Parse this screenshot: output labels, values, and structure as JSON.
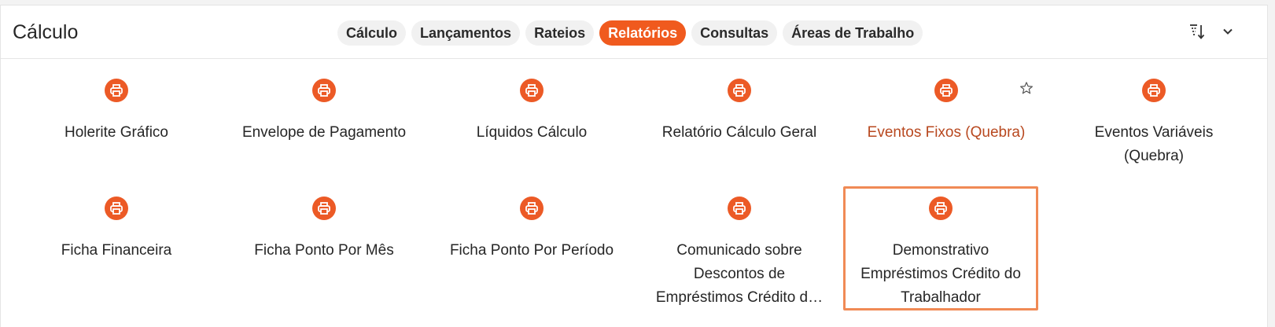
{
  "header": {
    "title": "Cálculo",
    "tabs": [
      {
        "label": "Cálculo"
      },
      {
        "label": "Lançamentos"
      },
      {
        "label": "Rateios"
      },
      {
        "label": "Relatórios"
      },
      {
        "label": "Consultas"
      },
      {
        "label": "Áreas de Trabalho"
      }
    ],
    "active_tab": "Relatórios",
    "tools": [
      "sort-icon",
      "chevron-down-icon"
    ]
  },
  "reports": [
    {
      "label": "Holerite Gráfico",
      "icon": "printer-icon"
    },
    {
      "label": "Envelope de Pagamento",
      "icon": "printer-icon"
    },
    {
      "label": "Líquidos Cálculo",
      "icon": "printer-icon"
    },
    {
      "label": "Relatório Cálculo Geral",
      "icon": "printer-icon"
    },
    {
      "label": "Eventos Fixos (Quebra)",
      "icon": "printer-icon",
      "hovered": true,
      "favorite_icon": "star-outline-icon"
    },
    {
      "label": "Eventos Variáveis (Quebra)",
      "icon": "printer-icon"
    },
    {
      "label": "Ficha Financeira",
      "icon": "printer-icon"
    },
    {
      "label": "Ficha Ponto Por Mês",
      "icon": "printer-icon"
    },
    {
      "label": "Ficha Ponto Por Período",
      "icon": "printer-icon"
    },
    {
      "label": "Comunicado sobre Descontos de Empréstimos Crédito d…",
      "icon": "printer-icon"
    },
    {
      "label": "Demonstrativo Empréstimos Crédito do Trabalhador",
      "icon": "printer-icon",
      "selected": true
    }
  ],
  "colors": {
    "accent": "#f05a1e",
    "icon_bg": "#ec5a26",
    "hover_text": "#b8481f",
    "selected_border": "#f08a55"
  }
}
